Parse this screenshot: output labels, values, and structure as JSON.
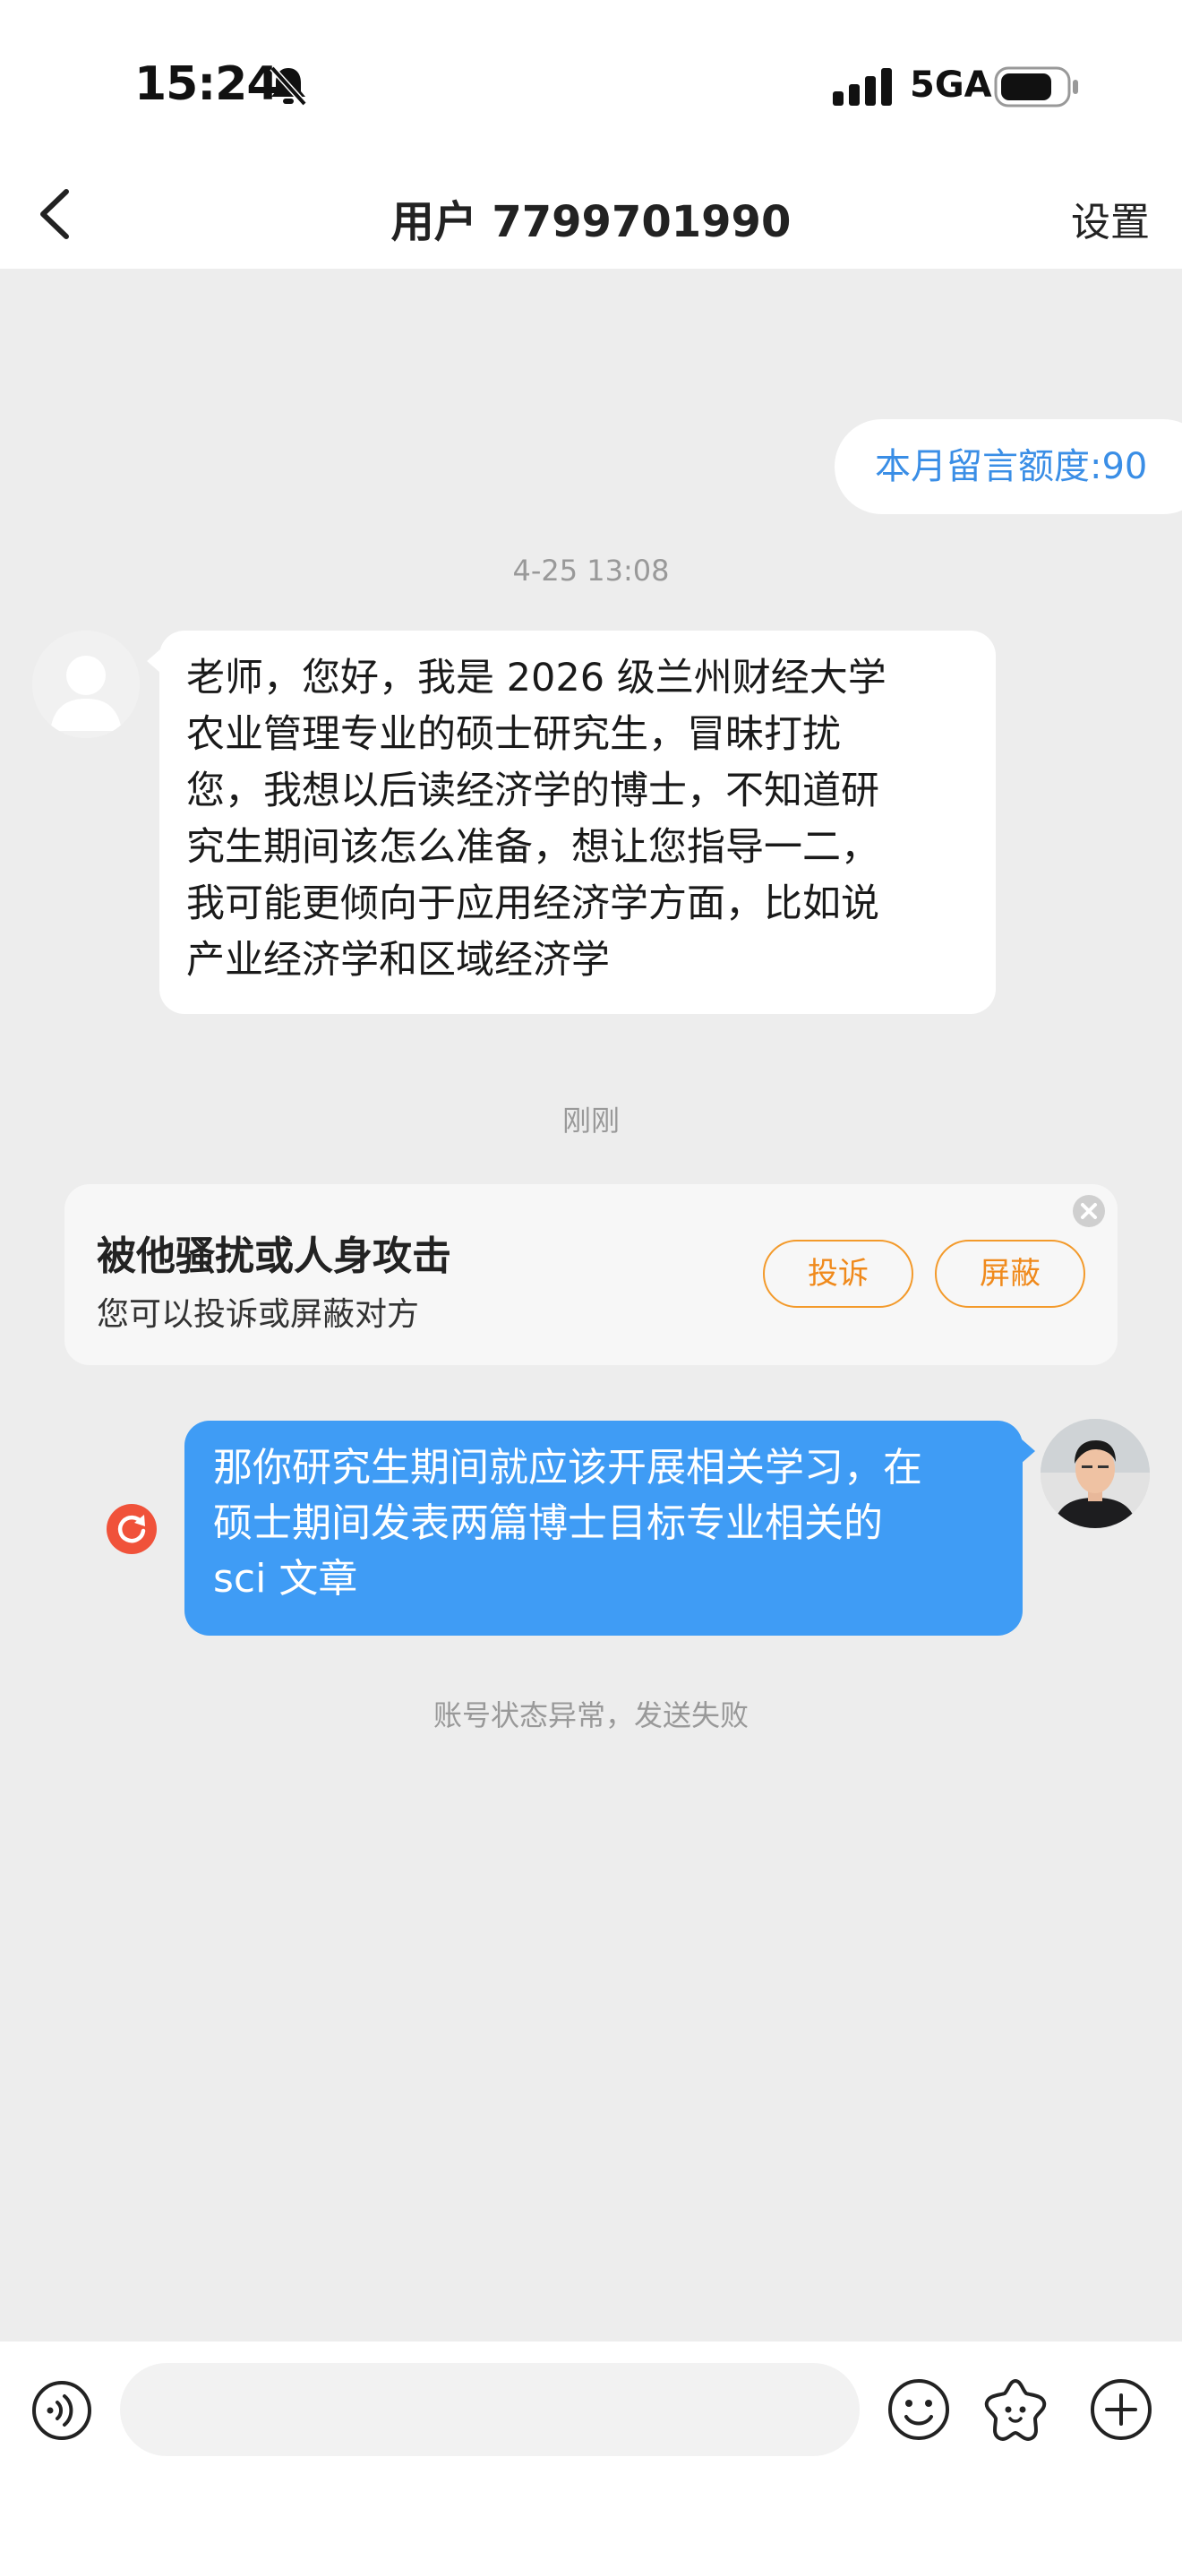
{
  "status_bar": {
    "time": "15:24",
    "network": "5GA"
  },
  "header": {
    "title": "用户 7799701990",
    "settings_label": "设置"
  },
  "chat": {
    "quota_text": "本月留言额度:90",
    "timestamp_1": "4-25 13:08",
    "incoming_message": "老师，您好，我是 2026 级兰州财经大学\n农业管理专业的硕士研究生，冒昧打扰\n您，我想以后读经济学的博士，不知道研\n究生期间该怎么准备，想让您指导一二，\n我可能更倾向于应用经济学方面，比如说\n产业经济学和区域经济学",
    "timestamp_2": "刚刚",
    "warning": {
      "title": "被他骚扰或人身攻击",
      "subtitle": "您可以投诉或屏蔽对方",
      "complain_label": "投诉",
      "block_label": "屏蔽"
    },
    "outgoing_message": "那你研究生期间就应该开展相关学习，在\n硕士期间发表两篇博士目标专业相关的\nsci 文章",
    "send_error": "账号状态异常，发送失败"
  },
  "colors": {
    "accent_blue": "#3f9cf5",
    "warn_orange": "#f08a1c",
    "error_red": "#f0523a"
  },
  "bottom_bar": {
    "icons": [
      "voice-icon",
      "emoji-icon",
      "sticker-icon",
      "plus-icon"
    ],
    "input_value": ""
  }
}
